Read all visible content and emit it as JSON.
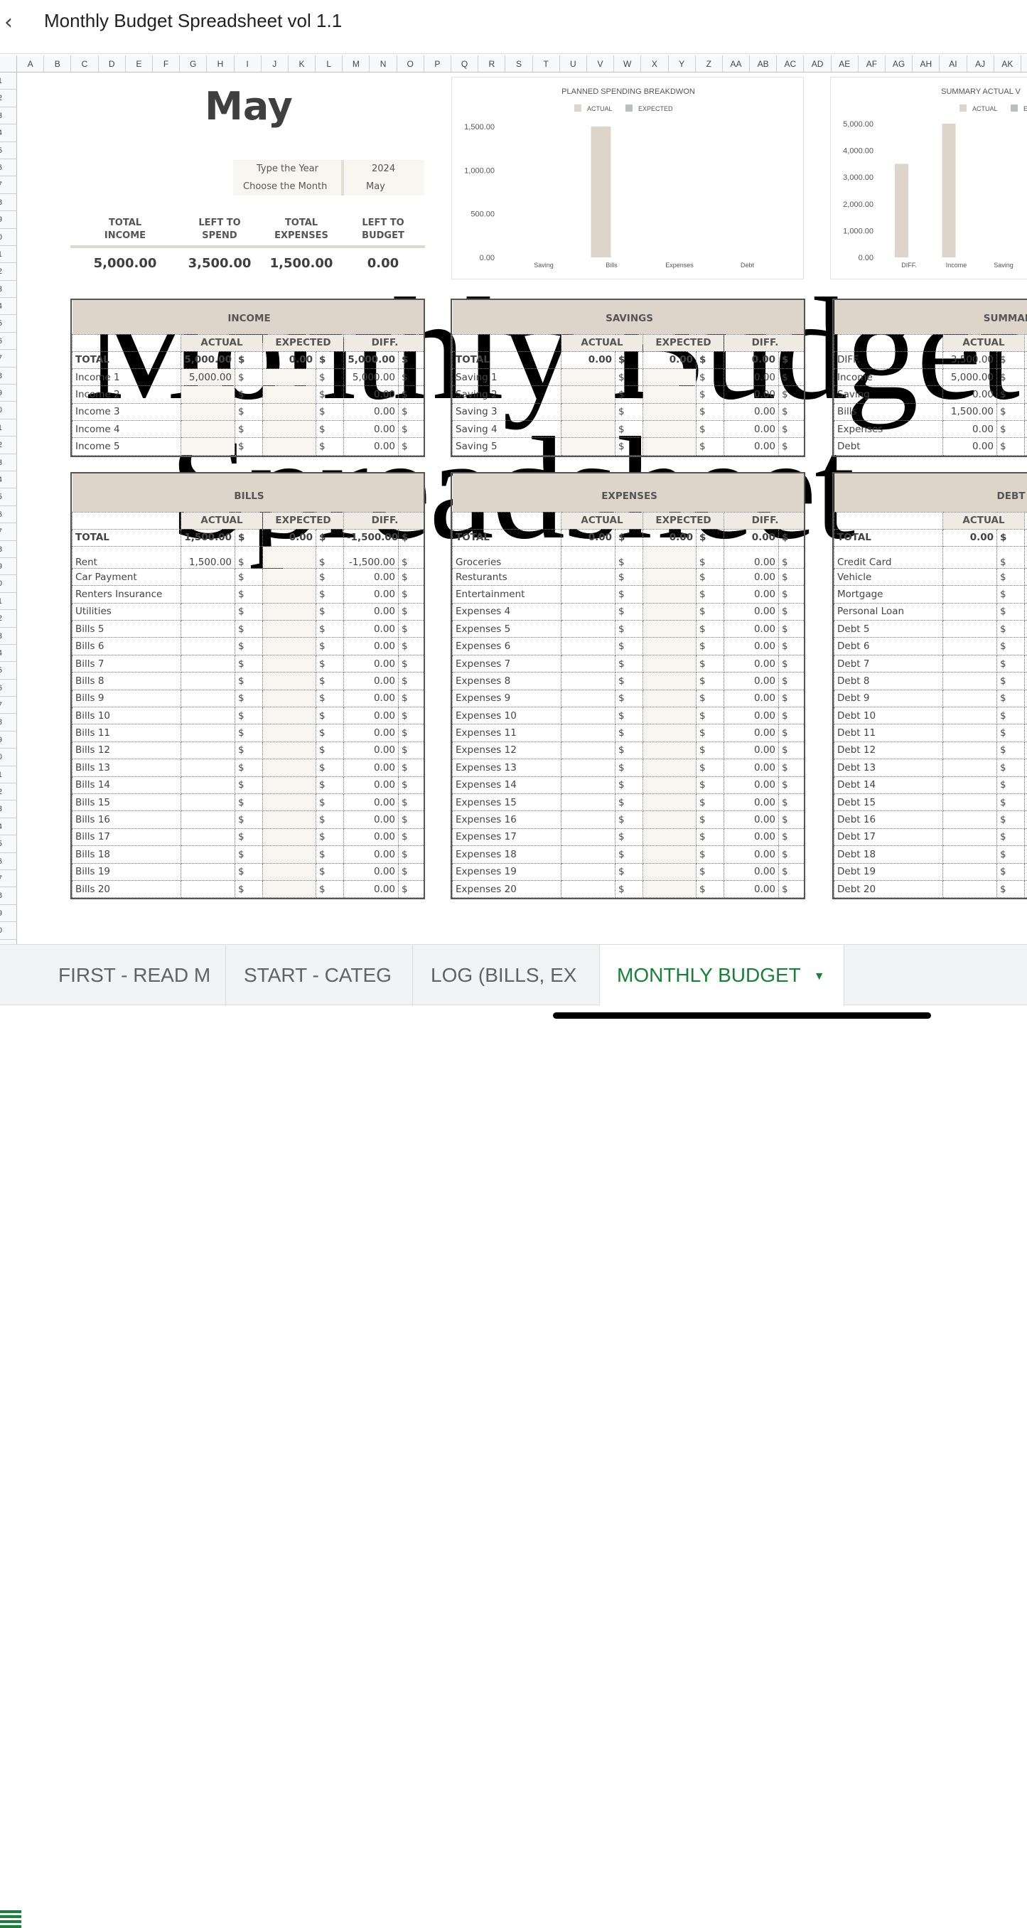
{
  "app": {
    "title": "Monthly Budget Spreadsheet vol 1.1",
    "back_icon": "chevron-left-icon"
  },
  "columns": [
    "A",
    "B",
    "C",
    "D",
    "E",
    "F",
    "G",
    "H",
    "I",
    "J",
    "K",
    "L",
    "M",
    "N",
    "O",
    "P",
    "Q",
    "R",
    "S",
    "T",
    "U",
    "V",
    "W",
    "X",
    "Y",
    "Z",
    "AA",
    "AB",
    "AC",
    "AD",
    "AE",
    "AF",
    "AG",
    "AH",
    "AI",
    "AJ",
    "AK"
  ],
  "rows": [
    "1",
    "2",
    "3",
    "4",
    "5",
    "6",
    "7",
    "8",
    "9",
    "10",
    "11",
    "12",
    "13",
    "14",
    "15",
    "16",
    "17",
    "18",
    "19",
    "20",
    "21",
    "22",
    "23",
    "24",
    "25",
    "26",
    "27",
    "28",
    "29",
    "30",
    "31",
    "32",
    "33",
    "34",
    "35",
    "36",
    "37",
    "38",
    "39",
    "40",
    "41",
    "42",
    "43",
    "44",
    "45",
    "46",
    "47",
    "48",
    "49",
    "50"
  ],
  "header": {
    "month_title": "May",
    "year_label": "Type the Year",
    "year_value": "2024",
    "month_label": "Choose the Month",
    "month_value": "May"
  },
  "summary": [
    {
      "label1": "TOTAL",
      "label2": "INCOME",
      "value": "5,000.00"
    },
    {
      "label1": "LEFT TO",
      "label2": "SPEND",
      "value": "3,500.00"
    },
    {
      "label1": "TOTAL",
      "label2": "EXPENSES",
      "value": "1,500.00"
    },
    {
      "label1": "LEFT TO",
      "label2": "BUDGET",
      "value": "0.00"
    }
  ],
  "chart_data": [
    {
      "type": "bar",
      "title": "PLANNED SPENDING BREAKDWON",
      "categories": [
        "Saving",
        "Bills",
        "Expenses",
        "Debt"
      ],
      "series": [
        {
          "name": "ACTUAL",
          "values": [
            0,
            1500,
            0,
            0
          ],
          "color": "#ddd5ca"
        },
        {
          "name": "EXPECTED",
          "values": [
            0,
            0,
            0,
            0
          ],
          "color": "#b9c2bc"
        }
      ],
      "ylim": [
        0,
        1500
      ],
      "yticks": [
        "0.00",
        "500.00",
        "1,000.00",
        "1,500.00"
      ],
      "ytick_values": [
        0,
        500,
        1000,
        1500
      ],
      "legend": "top",
      "grid": false
    },
    {
      "type": "bar",
      "title": "SUMMARY ACTUAL V",
      "categories": [
        "DIFF.",
        "Income",
        "Saving"
      ],
      "series": [
        {
          "name": "ACTUAL",
          "values": [
            3500,
            5000,
            0
          ],
          "color": "#ddd5ca"
        },
        {
          "name": "E",
          "values": [
            0,
            0,
            0
          ],
          "color": "#b9c2bc"
        }
      ],
      "ylim": [
        0,
        5000
      ],
      "yticks": [
        "0.00",
        "1,000.00",
        "2,000.00",
        "3,000.00",
        "4,000.00",
        "5,000.00"
      ],
      "ytick_values": [
        0,
        1000,
        2000,
        3000,
        4000,
        5000
      ],
      "legend": "top",
      "grid": false
    }
  ],
  "currency": "$",
  "tables": [
    {
      "id": "income",
      "title": "INCOME",
      "headers": [
        "ACTUAL",
        "EXPECTED",
        "DIFF."
      ],
      "total": [
        "TOTAL",
        "5,000.00",
        "0.00",
        "5,000.00"
      ],
      "rows": [
        [
          "Income 1",
          "5,000.00",
          "",
          "5,000.00"
        ],
        [
          "Income 2",
          "",
          "",
          "0.00"
        ],
        [
          "Income 3",
          "",
          "",
          "0.00"
        ],
        [
          "Income 4",
          "",
          "",
          "0.00"
        ],
        [
          "Income 5",
          "",
          "",
          "0.00"
        ]
      ]
    },
    {
      "id": "savings",
      "title": "SAVINGS",
      "headers": [
        "ACTUAL",
        "EXPECTED",
        "DIFF."
      ],
      "total": [
        "TOTAL",
        "0.00",
        "0.00",
        "0.00"
      ],
      "rows": [
        [
          "Saving 1",
          "",
          "",
          "0.00"
        ],
        [
          "Saving 2",
          "",
          "",
          "0.00"
        ],
        [
          "Saving 3",
          "",
          "",
          "0.00"
        ],
        [
          "Saving 4",
          "",
          "",
          "0.00"
        ],
        [
          "Saving 5",
          "",
          "",
          "0.00"
        ]
      ]
    },
    {
      "id": "summary",
      "title": "SUMMARY",
      "headers": [
        "ACTUAL",
        "",
        ""
      ],
      "total": null,
      "rows": [
        [
          "DIFF.",
          "3,500.00",
          "",
          ""
        ],
        [
          "Income",
          "5,000.00",
          "",
          ""
        ],
        [
          "Saving",
          "0.00",
          "",
          ""
        ],
        [
          "Bills",
          "1,500.00",
          "",
          ""
        ],
        [
          "Expenses",
          "0.00",
          "",
          ""
        ],
        [
          "Debt",
          "0.00",
          "",
          ""
        ]
      ]
    },
    {
      "id": "bills",
      "title": "BILLS",
      "headers": [
        "ACTUAL",
        "EXPECTED",
        "DIFF."
      ],
      "total": [
        "TOTAL",
        "1,500.00",
        "0.00",
        "-1,500.00"
      ],
      "rows": [
        [
          "Rent",
          "1,500.00",
          "",
          "-1,500.00"
        ],
        [
          "Car Payment",
          "",
          "",
          "0.00"
        ],
        [
          "Renters Insurance",
          "",
          "",
          "0.00"
        ],
        [
          "Utilities",
          "",
          "",
          "0.00"
        ],
        [
          "Bills 5",
          "",
          "",
          "0.00"
        ],
        [
          "Bills 6",
          "",
          "",
          "0.00"
        ],
        [
          "Bills 7",
          "",
          "",
          "0.00"
        ],
        [
          "Bills 8",
          "",
          "",
          "0.00"
        ],
        [
          "Bills 9",
          "",
          "",
          "0.00"
        ],
        [
          "Bills 10",
          "",
          "",
          "0.00"
        ],
        [
          "Bills 11",
          "",
          "",
          "0.00"
        ],
        [
          "Bills 12",
          "",
          "",
          "0.00"
        ],
        [
          "Bills 13",
          "",
          "",
          "0.00"
        ],
        [
          "Bills 14",
          "",
          "",
          "0.00"
        ],
        [
          "Bills 15",
          "",
          "",
          "0.00"
        ],
        [
          "Bills 16",
          "",
          "",
          "0.00"
        ],
        [
          "Bills 17",
          "",
          "",
          "0.00"
        ],
        [
          "Bills 18",
          "",
          "",
          "0.00"
        ],
        [
          "Bills 19",
          "",
          "",
          "0.00"
        ],
        [
          "Bills 20",
          "",
          "",
          "0.00"
        ]
      ]
    },
    {
      "id": "expenses",
      "title": "EXPENSES",
      "headers": [
        "ACTUAL",
        "EXPECTED",
        "DIFF."
      ],
      "total": [
        "TOTAL",
        "0.00",
        "0.00",
        "0.00"
      ],
      "rows": [
        [
          "Groceries",
          "",
          "",
          "0.00"
        ],
        [
          "Resturants",
          "",
          "",
          "0.00"
        ],
        [
          "Entertainment",
          "",
          "",
          "0.00"
        ],
        [
          "Expenses 4",
          "",
          "",
          "0.00"
        ],
        [
          "Expenses 5",
          "",
          "",
          "0.00"
        ],
        [
          "Expenses 6",
          "",
          "",
          "0.00"
        ],
        [
          "Expenses 7",
          "",
          "",
          "0.00"
        ],
        [
          "Expenses 8",
          "",
          "",
          "0.00"
        ],
        [
          "Expenses 9",
          "",
          "",
          "0.00"
        ],
        [
          "Expenses 10",
          "",
          "",
          "0.00"
        ],
        [
          "Expenses 11",
          "",
          "",
          "0.00"
        ],
        [
          "Expenses 12",
          "",
          "",
          "0.00"
        ],
        [
          "Expenses 13",
          "",
          "",
          "0.00"
        ],
        [
          "Expenses 14",
          "",
          "",
          "0.00"
        ],
        [
          "Expenses 15",
          "",
          "",
          "0.00"
        ],
        [
          "Expenses 16",
          "",
          "",
          "0.00"
        ],
        [
          "Expenses 17",
          "",
          "",
          "0.00"
        ],
        [
          "Expenses 18",
          "",
          "",
          "0.00"
        ],
        [
          "Expenses 19",
          "",
          "",
          "0.00"
        ],
        [
          "Expenses 20",
          "",
          "",
          "0.00"
        ]
      ]
    },
    {
      "id": "debt",
      "title": "DEBT",
      "headers": [
        "ACTUAL",
        "",
        ""
      ],
      "total": [
        "TOTAL",
        "0.00",
        "",
        ""
      ],
      "rows": [
        [
          "Credit Card",
          "",
          "",
          ""
        ],
        [
          "Vehicle",
          "",
          "",
          ""
        ],
        [
          "Mortgage",
          "",
          "",
          ""
        ],
        [
          "Personal Loan",
          "",
          "",
          ""
        ],
        [
          "Debt 5",
          "",
          "",
          ""
        ],
        [
          "Debt 6",
          "",
          "",
          ""
        ],
        [
          "Debt 7",
          "",
          "",
          ""
        ],
        [
          "Debt 8",
          "",
          "",
          ""
        ],
        [
          "Debt 9",
          "",
          "",
          ""
        ],
        [
          "Debt 10",
          "",
          "",
          ""
        ],
        [
          "Debt 11",
          "",
          "",
          ""
        ],
        [
          "Debt 12",
          "",
          "",
          ""
        ],
        [
          "Debt 13",
          "",
          "",
          ""
        ],
        [
          "Debt 14",
          "",
          "",
          ""
        ],
        [
          "Debt 15",
          "",
          "",
          ""
        ],
        [
          "Debt 16",
          "",
          "",
          ""
        ],
        [
          "Debt 17",
          "",
          "",
          ""
        ],
        [
          "Debt 18",
          "",
          "",
          ""
        ],
        [
          "Debt 19",
          "",
          "",
          ""
        ],
        [
          "Debt 20",
          "",
          "",
          ""
        ]
      ]
    }
  ],
  "overlay": {
    "line1": "Monthly Budget",
    "line2": "Spreadsheet"
  },
  "sheet_tabs": [
    {
      "label": "FIRST - READ M",
      "active": false
    },
    {
      "label": "START - CATEG",
      "active": false
    },
    {
      "label": "LOG (BILLS, EX",
      "active": false
    },
    {
      "label": "MONTHLY BUDGET",
      "active": true,
      "icon": "caret-down-icon"
    }
  ],
  "accent_color": "#188038"
}
